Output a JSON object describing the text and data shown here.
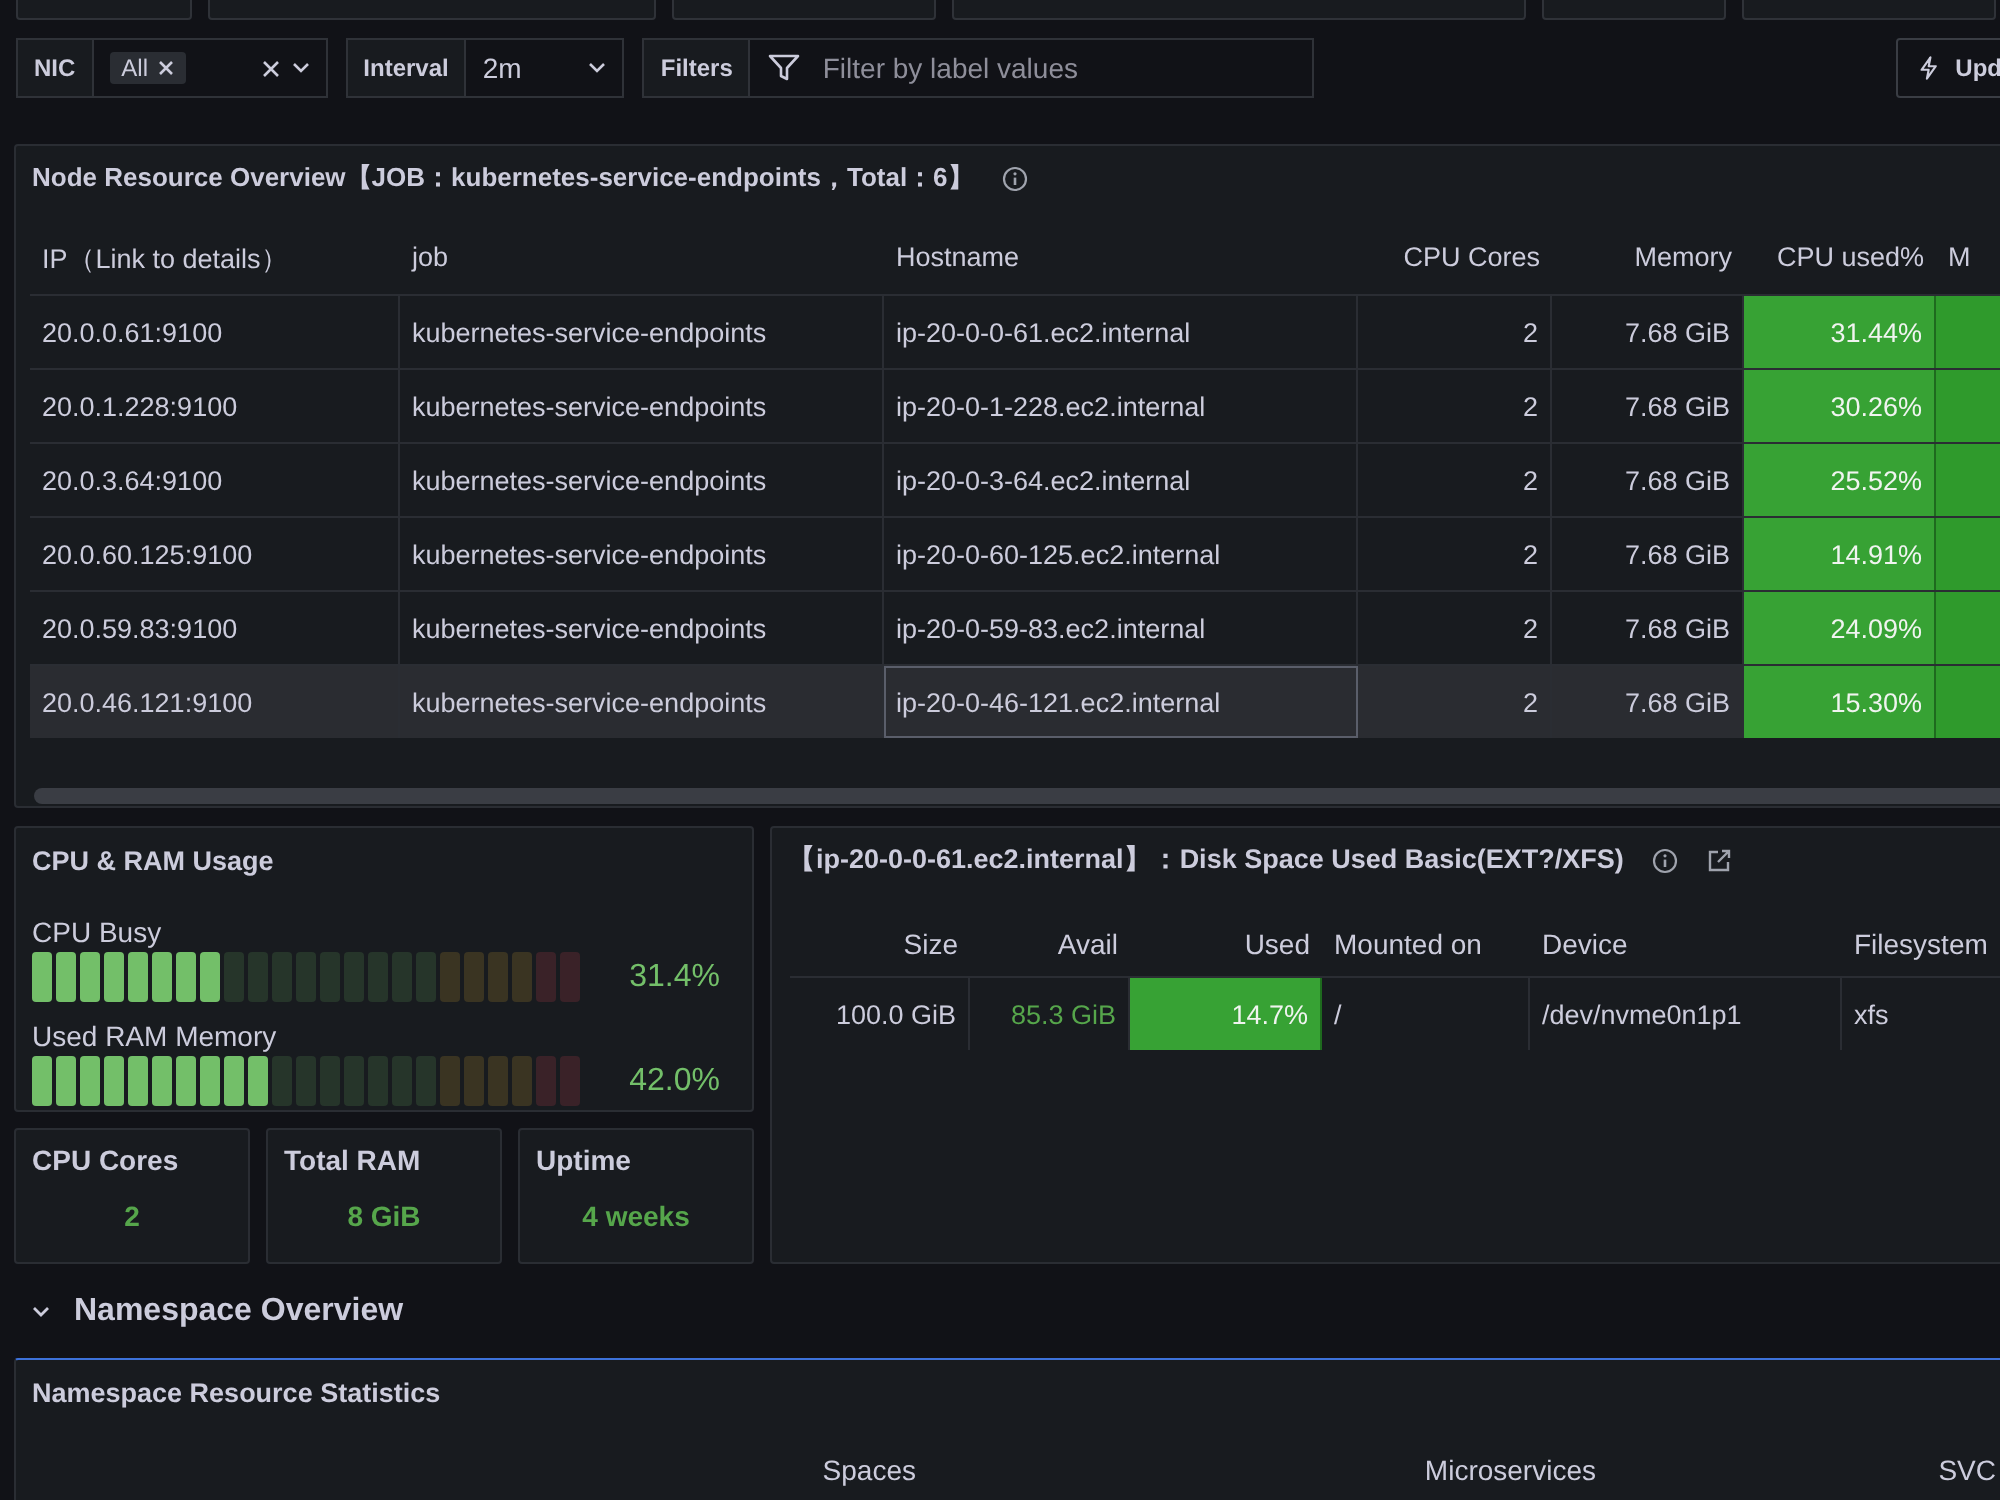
{
  "variables": {
    "nic": {
      "label": "NIC",
      "chips": [
        "All"
      ]
    },
    "interval": {
      "label": "Interval",
      "value": "2m"
    },
    "filters": {
      "label": "Filters",
      "placeholder": "Filter by label values"
    },
    "update_button": "Upd"
  },
  "node_table": {
    "title": "Node Resource Overview【JOB：kubernetes-service-endpoints，Total：6】",
    "columns": [
      "IP（Link to details）",
      "job",
      "Hostname",
      "CPU Cores",
      "Memory",
      "CPU used%",
      "M"
    ],
    "rows": [
      {
        "cells": [
          "20.0.0.61:9100",
          "kubernetes-service-endpoints",
          "ip-20-0-0-61.ec2.internal",
          "2",
          "7.68 GiB",
          "31.44%"
        ],
        "selected": false
      },
      {
        "cells": [
          "20.0.1.228:9100",
          "kubernetes-service-endpoints",
          "ip-20-0-1-228.ec2.internal",
          "2",
          "7.68 GiB",
          "30.26%"
        ],
        "selected": false
      },
      {
        "cells": [
          "20.0.3.64:9100",
          "kubernetes-service-endpoints",
          "ip-20-0-3-64.ec2.internal",
          "2",
          "7.68 GiB",
          "25.52%"
        ],
        "selected": false
      },
      {
        "cells": [
          "20.0.60.125:9100",
          "kubernetes-service-endpoints",
          "ip-20-0-60-125.ec2.internal",
          "2",
          "7.68 GiB",
          "14.91%"
        ],
        "selected": false
      },
      {
        "cells": [
          "20.0.59.83:9100",
          "kubernetes-service-endpoints",
          "ip-20-0-59-83.ec2.internal",
          "2",
          "7.68 GiB",
          "24.09%"
        ],
        "selected": false
      },
      {
        "cells": [
          "20.0.46.121:9100",
          "kubernetes-service-endpoints",
          "ip-20-0-46-121.ec2.internal",
          "2",
          "7.68 GiB",
          "15.30%"
        ],
        "selected": true
      }
    ]
  },
  "cpu_ram": {
    "title": "CPU & RAM Usage",
    "gauges": [
      {
        "label": "CPU Busy",
        "level": 0.314,
        "reading": "31.4%"
      },
      {
        "label": "Used RAM Memory",
        "level": 0.42,
        "reading": "42.0%"
      }
    ]
  },
  "stats": [
    {
      "title": "CPU Cores",
      "value": "2"
    },
    {
      "title": "Total RAM",
      "value": "8 GiB"
    },
    {
      "title": "Uptime",
      "value": "4 weeks"
    }
  ],
  "disk": {
    "title": "【ip-20-0-0-61.ec2.internal】：Disk Space Used Basic(EXT?/XFS)",
    "columns": [
      "Size",
      "Avail",
      "Used",
      "Mounted on",
      "Device",
      "Filesystem"
    ],
    "rows": [
      {
        "cells": [
          "100.0 GiB",
          "85.3 GiB",
          "14.7%",
          "/",
          "/dev/nvme0n1p1",
          "xfs"
        ]
      }
    ]
  },
  "namespace": {
    "row_title": "Namespace Overview",
    "expanded": true,
    "panel_title": "Namespace Resource Statistics",
    "columns": [
      "Spaces",
      "Microservices",
      "SVC"
    ]
  }
}
